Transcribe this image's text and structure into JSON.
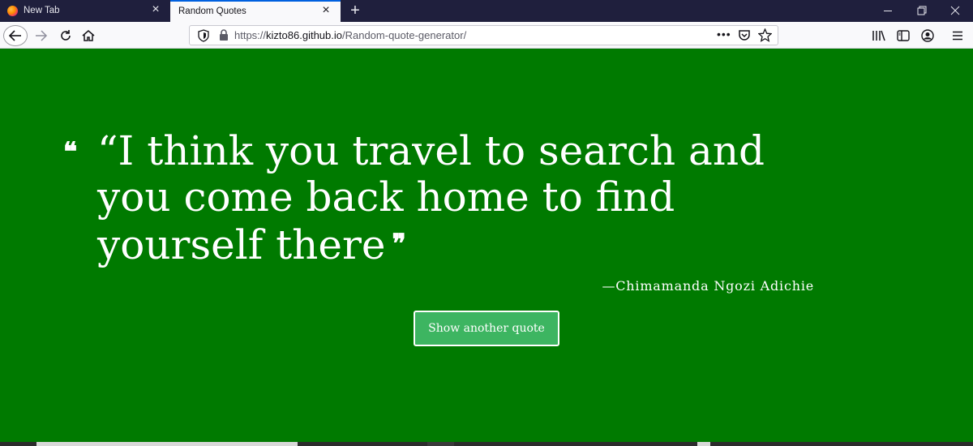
{
  "browser": {
    "tabs": [
      {
        "label": "New Tab",
        "close": "×"
      },
      {
        "label": "Random Quotes",
        "close": "×"
      }
    ],
    "new_tab_symbol": "+",
    "url": {
      "prefix": "https://",
      "host": "kizto86.github.io",
      "path": "/Random-quote-generator/"
    },
    "page_actions_symbol": "•••",
    "icons": {
      "tab_favicon": "firefox-icon",
      "back": "arrow-left-icon",
      "forward": "arrow-right-icon",
      "reload": "reload-icon",
      "home": "home-icon",
      "tracking": "shield-icon",
      "lock": "lock-icon",
      "pocket": "pocket-icon",
      "bookmark": "star-icon",
      "library": "library-icon",
      "sidebar": "sidebar-icon",
      "account": "account-icon",
      "menu": "hamburger-menu-icon",
      "minimize": "minimize-icon",
      "restore": "restore-icon",
      "close": "close-icon"
    }
  },
  "page": {
    "background": "#007a00",
    "quote_open_mark": "❝",
    "quote_text": "“I think you travel to search and you come back home to find yourself there",
    "quote_close_mark": "❞",
    "author": "—Chimamanda Ngozi Adichie",
    "button_label": "Show another quote",
    "button_color": "#3db561"
  }
}
